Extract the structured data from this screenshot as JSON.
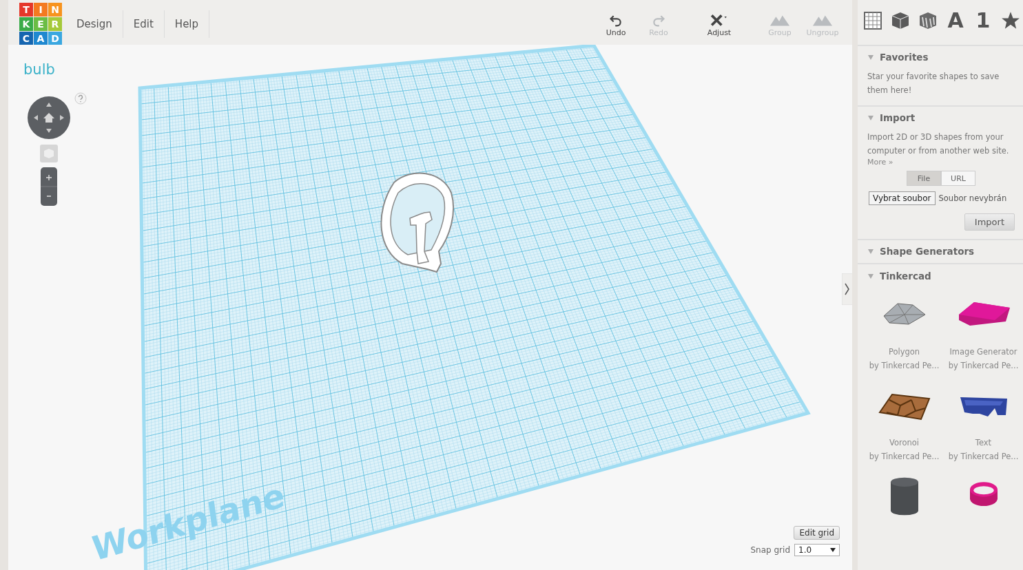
{
  "logo": [
    {
      "letter": "T",
      "color": "#e5372a"
    },
    {
      "letter": "I",
      "color": "#f47a20"
    },
    {
      "letter": "N",
      "color": "#f7931e"
    },
    {
      "letter": "K",
      "color": "#3aab49"
    },
    {
      "letter": "E",
      "color": "#6bbd45"
    },
    {
      "letter": "R",
      "color": "#a5c93a"
    },
    {
      "letter": "C",
      "color": "#1565b0"
    },
    {
      "letter": "A",
      "color": "#1e88d0"
    },
    {
      "letter": "D",
      "color": "#3aa7e0"
    }
  ],
  "menu": [
    {
      "label": "Design"
    },
    {
      "label": "Edit"
    },
    {
      "label": "Help"
    }
  ],
  "project": {
    "name": "bulb"
  },
  "toolbar": [
    {
      "label": "Undo",
      "kind": "undo",
      "disabled": false
    },
    {
      "label": "Redo",
      "kind": "redo",
      "disabled": true
    },
    {
      "label": "Adjust",
      "kind": "adjust",
      "disabled": false
    },
    {
      "label": "Group",
      "kind": "group",
      "disabled": true
    },
    {
      "label": "Ungroup",
      "kind": "ungroup",
      "disabled": true
    }
  ],
  "category_tabs": [
    {
      "kind": "grid"
    },
    {
      "kind": "box"
    },
    {
      "kind": "striped"
    },
    {
      "kind": "glyph",
      "glyph": "A"
    },
    {
      "kind": "glyph",
      "glyph": "1"
    },
    {
      "kind": "star"
    }
  ],
  "workplane": {
    "label": "Workplane"
  },
  "grid_controls": {
    "edit_button": "Edit grid",
    "snap_label": "Snap grid",
    "snap_value": "1.0"
  },
  "sidebar": {
    "favorites": {
      "title": "Favorites",
      "expanded": true,
      "text": "Star your favorite shapes to save them here!"
    },
    "import": {
      "title": "Import",
      "expanded": true,
      "text": "Import 2D or 3D shapes from your computer or from another web site.",
      "link": "More »",
      "tabs": [
        {
          "label": "File",
          "selected": true
        },
        {
          "label": "URL",
          "selected": false
        }
      ],
      "file_button": "Vybrat soubor",
      "file_status": "Soubor nevybrán",
      "import_button": "Import"
    },
    "shape_generators": {
      "title": "Shape Generators",
      "expanded": true,
      "groups": [
        {
          "title": "Tinkercad",
          "expanded": true,
          "shapes": [
            {
              "kind": "polygon",
              "name": "Polygon",
              "author": "by Tinkercad Pe..."
            },
            {
              "kind": "image",
              "name": "Image Generator",
              "author": "by Tinkercad Pe..."
            },
            {
              "kind": "voronoi",
              "name": "Voronoi",
              "author": "by Tinkercad Pe..."
            },
            {
              "kind": "text",
              "name": "Text",
              "author": "by Tinkercad Pe..."
            },
            {
              "kind": "cylinder"
            },
            {
              "kind": "ring"
            }
          ]
        }
      ]
    }
  }
}
